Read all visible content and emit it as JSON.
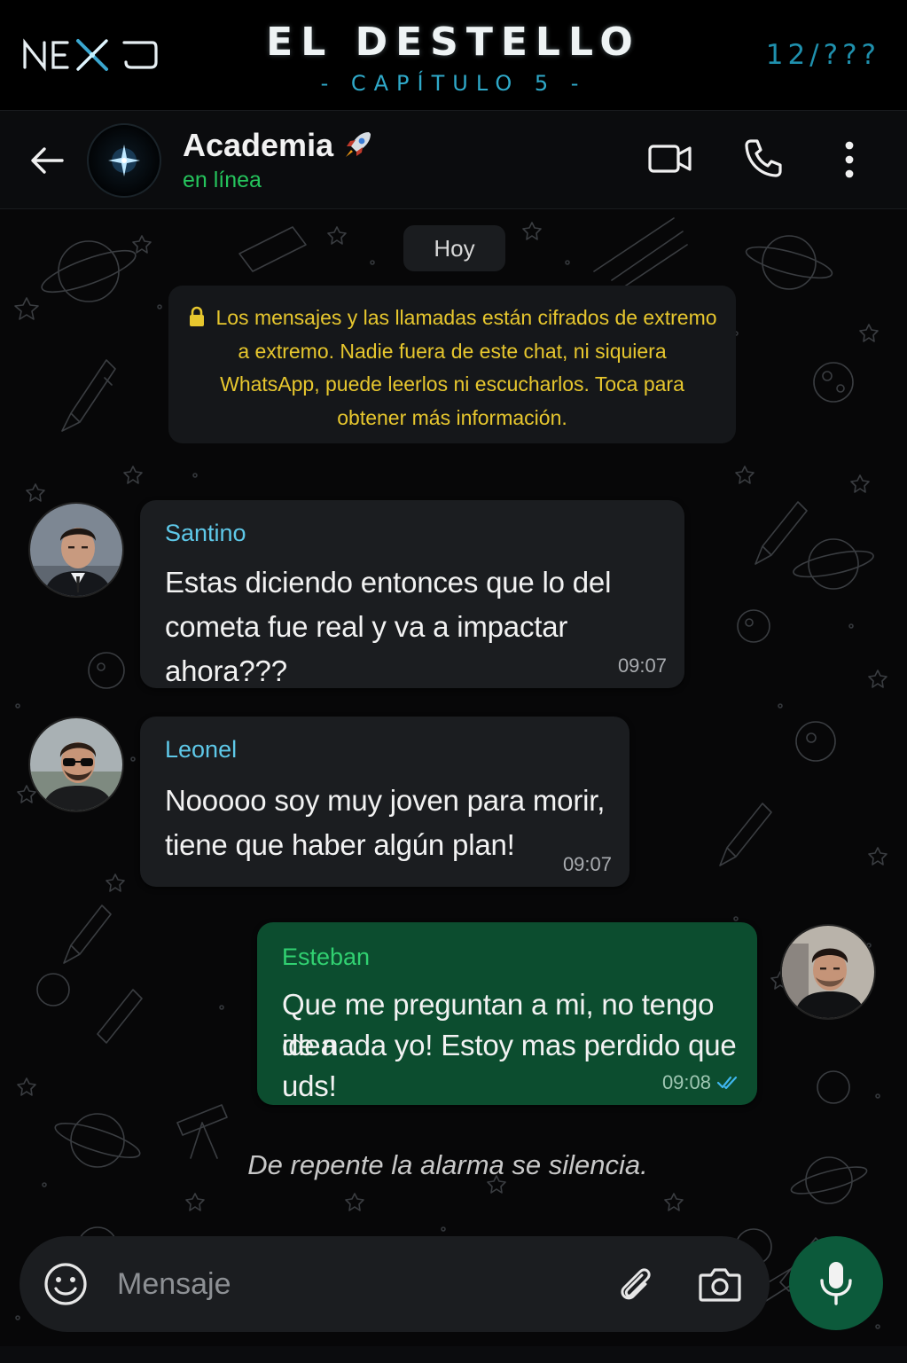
{
  "story": {
    "brand": "NEXO",
    "title": "EL DESTELLO",
    "chapter": "- CAPÍTULO 5 -",
    "counter": "12/???"
  },
  "chat_header": {
    "group_name": "Academia",
    "group_emoji": "rocket-icon",
    "status": "en línea",
    "icons": [
      "back-arrow-icon",
      "video-camera-icon",
      "phone-icon",
      "more-vertical-icon"
    ]
  },
  "chat": {
    "date_label": "Hoy",
    "encryption_notice": "Los mensajes y las llamadas están cifrados de extremo a extremo. Nadie fuera de este chat, ni siquiera WhatsApp, puede leerlos ni escucharlos. Toca para obtener más información.",
    "messages": [
      {
        "sender": "Santino",
        "direction": "incoming",
        "lines": [
          "Estas diciendo entonces que lo del",
          "cometa fue real y va a impactar ahora???"
        ],
        "time": "09:07"
      },
      {
        "sender": "Leonel",
        "direction": "incoming",
        "lines": [
          "Nooooo soy muy joven para morir,",
          "tiene que haber algún plan!"
        ],
        "time": "09:07"
      },
      {
        "sender": "Esteban",
        "direction": "outgoing",
        "lines": [
          "Que me preguntan a mi, no tengo idea",
          "de nada yo! Estoy mas perdido que uds!"
        ],
        "time": "09:08",
        "read_status": "double-check-read-icon"
      }
    ],
    "narration": "De repente la alarma se silencia."
  },
  "composer": {
    "placeholder": "Mensaje",
    "value": "",
    "icons": [
      "emoji-icon",
      "paperclip-icon",
      "camera-icon",
      "microphone-icon"
    ]
  },
  "colors": {
    "accent_green": "#25c45c",
    "outgoing_bubble": "#0c4d2f",
    "incoming_bubble": "#1b1d20",
    "sender_blue": "#5ec8e8",
    "notice_yellow": "#e7c72e",
    "chapter_cyan": "#2fa9c9"
  }
}
